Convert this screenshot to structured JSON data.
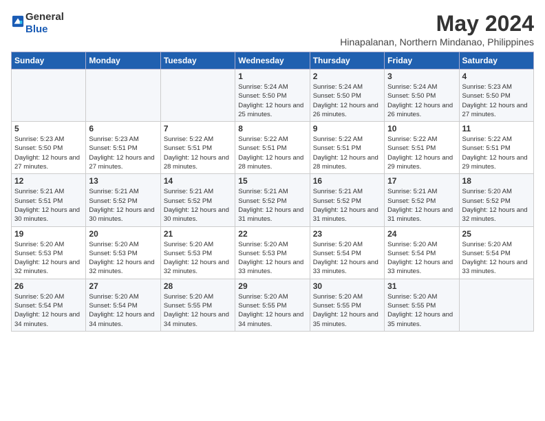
{
  "logo": {
    "general": "General",
    "blue": "Blue"
  },
  "header": {
    "title": "May 2024",
    "subtitle": "Hinapalanan, Northern Mindanao, Philippines"
  },
  "weekdays": [
    "Sunday",
    "Monday",
    "Tuesday",
    "Wednesday",
    "Thursday",
    "Friday",
    "Saturday"
  ],
  "weeks": [
    [
      {
        "day": "",
        "sunrise": "",
        "sunset": "",
        "daylight": ""
      },
      {
        "day": "",
        "sunrise": "",
        "sunset": "",
        "daylight": ""
      },
      {
        "day": "",
        "sunrise": "",
        "sunset": "",
        "daylight": ""
      },
      {
        "day": "1",
        "sunrise": "Sunrise: 5:24 AM",
        "sunset": "Sunset: 5:50 PM",
        "daylight": "Daylight: 12 hours and 25 minutes."
      },
      {
        "day": "2",
        "sunrise": "Sunrise: 5:24 AM",
        "sunset": "Sunset: 5:50 PM",
        "daylight": "Daylight: 12 hours and 26 minutes."
      },
      {
        "day": "3",
        "sunrise": "Sunrise: 5:24 AM",
        "sunset": "Sunset: 5:50 PM",
        "daylight": "Daylight: 12 hours and 26 minutes."
      },
      {
        "day": "4",
        "sunrise": "Sunrise: 5:23 AM",
        "sunset": "Sunset: 5:50 PM",
        "daylight": "Daylight: 12 hours and 27 minutes."
      }
    ],
    [
      {
        "day": "5",
        "sunrise": "Sunrise: 5:23 AM",
        "sunset": "Sunset: 5:50 PM",
        "daylight": "Daylight: 12 hours and 27 minutes."
      },
      {
        "day": "6",
        "sunrise": "Sunrise: 5:23 AM",
        "sunset": "Sunset: 5:51 PM",
        "daylight": "Daylight: 12 hours and 27 minutes."
      },
      {
        "day": "7",
        "sunrise": "Sunrise: 5:22 AM",
        "sunset": "Sunset: 5:51 PM",
        "daylight": "Daylight: 12 hours and 28 minutes."
      },
      {
        "day": "8",
        "sunrise": "Sunrise: 5:22 AM",
        "sunset": "Sunset: 5:51 PM",
        "daylight": "Daylight: 12 hours and 28 minutes."
      },
      {
        "day": "9",
        "sunrise": "Sunrise: 5:22 AM",
        "sunset": "Sunset: 5:51 PM",
        "daylight": "Daylight: 12 hours and 28 minutes."
      },
      {
        "day": "10",
        "sunrise": "Sunrise: 5:22 AM",
        "sunset": "Sunset: 5:51 PM",
        "daylight": "Daylight: 12 hours and 29 minutes."
      },
      {
        "day": "11",
        "sunrise": "Sunrise: 5:22 AM",
        "sunset": "Sunset: 5:51 PM",
        "daylight": "Daylight: 12 hours and 29 minutes."
      }
    ],
    [
      {
        "day": "12",
        "sunrise": "Sunrise: 5:21 AM",
        "sunset": "Sunset: 5:51 PM",
        "daylight": "Daylight: 12 hours and 30 minutes."
      },
      {
        "day": "13",
        "sunrise": "Sunrise: 5:21 AM",
        "sunset": "Sunset: 5:52 PM",
        "daylight": "Daylight: 12 hours and 30 minutes."
      },
      {
        "day": "14",
        "sunrise": "Sunrise: 5:21 AM",
        "sunset": "Sunset: 5:52 PM",
        "daylight": "Daylight: 12 hours and 30 minutes."
      },
      {
        "day": "15",
        "sunrise": "Sunrise: 5:21 AM",
        "sunset": "Sunset: 5:52 PM",
        "daylight": "Daylight: 12 hours and 31 minutes."
      },
      {
        "day": "16",
        "sunrise": "Sunrise: 5:21 AM",
        "sunset": "Sunset: 5:52 PM",
        "daylight": "Daylight: 12 hours and 31 minutes."
      },
      {
        "day": "17",
        "sunrise": "Sunrise: 5:21 AM",
        "sunset": "Sunset: 5:52 PM",
        "daylight": "Daylight: 12 hours and 31 minutes."
      },
      {
        "day": "18",
        "sunrise": "Sunrise: 5:20 AM",
        "sunset": "Sunset: 5:52 PM",
        "daylight": "Daylight: 12 hours and 32 minutes."
      }
    ],
    [
      {
        "day": "19",
        "sunrise": "Sunrise: 5:20 AM",
        "sunset": "Sunset: 5:53 PM",
        "daylight": "Daylight: 12 hours and 32 minutes."
      },
      {
        "day": "20",
        "sunrise": "Sunrise: 5:20 AM",
        "sunset": "Sunset: 5:53 PM",
        "daylight": "Daylight: 12 hours and 32 minutes."
      },
      {
        "day": "21",
        "sunrise": "Sunrise: 5:20 AM",
        "sunset": "Sunset: 5:53 PM",
        "daylight": "Daylight: 12 hours and 32 minutes."
      },
      {
        "day": "22",
        "sunrise": "Sunrise: 5:20 AM",
        "sunset": "Sunset: 5:53 PM",
        "daylight": "Daylight: 12 hours and 33 minutes."
      },
      {
        "day": "23",
        "sunrise": "Sunrise: 5:20 AM",
        "sunset": "Sunset: 5:54 PM",
        "daylight": "Daylight: 12 hours and 33 minutes."
      },
      {
        "day": "24",
        "sunrise": "Sunrise: 5:20 AM",
        "sunset": "Sunset: 5:54 PM",
        "daylight": "Daylight: 12 hours and 33 minutes."
      },
      {
        "day": "25",
        "sunrise": "Sunrise: 5:20 AM",
        "sunset": "Sunset: 5:54 PM",
        "daylight": "Daylight: 12 hours and 33 minutes."
      }
    ],
    [
      {
        "day": "26",
        "sunrise": "Sunrise: 5:20 AM",
        "sunset": "Sunset: 5:54 PM",
        "daylight": "Daylight: 12 hours and 34 minutes."
      },
      {
        "day": "27",
        "sunrise": "Sunrise: 5:20 AM",
        "sunset": "Sunset: 5:54 PM",
        "daylight": "Daylight: 12 hours and 34 minutes."
      },
      {
        "day": "28",
        "sunrise": "Sunrise: 5:20 AM",
        "sunset": "Sunset: 5:55 PM",
        "daylight": "Daylight: 12 hours and 34 minutes."
      },
      {
        "day": "29",
        "sunrise": "Sunrise: 5:20 AM",
        "sunset": "Sunset: 5:55 PM",
        "daylight": "Daylight: 12 hours and 34 minutes."
      },
      {
        "day": "30",
        "sunrise": "Sunrise: 5:20 AM",
        "sunset": "Sunset: 5:55 PM",
        "daylight": "Daylight: 12 hours and 35 minutes."
      },
      {
        "day": "31",
        "sunrise": "Sunrise: 5:20 AM",
        "sunset": "Sunset: 5:55 PM",
        "daylight": "Daylight: 12 hours and 35 minutes."
      },
      {
        "day": "",
        "sunrise": "",
        "sunset": "",
        "daylight": ""
      }
    ]
  ]
}
